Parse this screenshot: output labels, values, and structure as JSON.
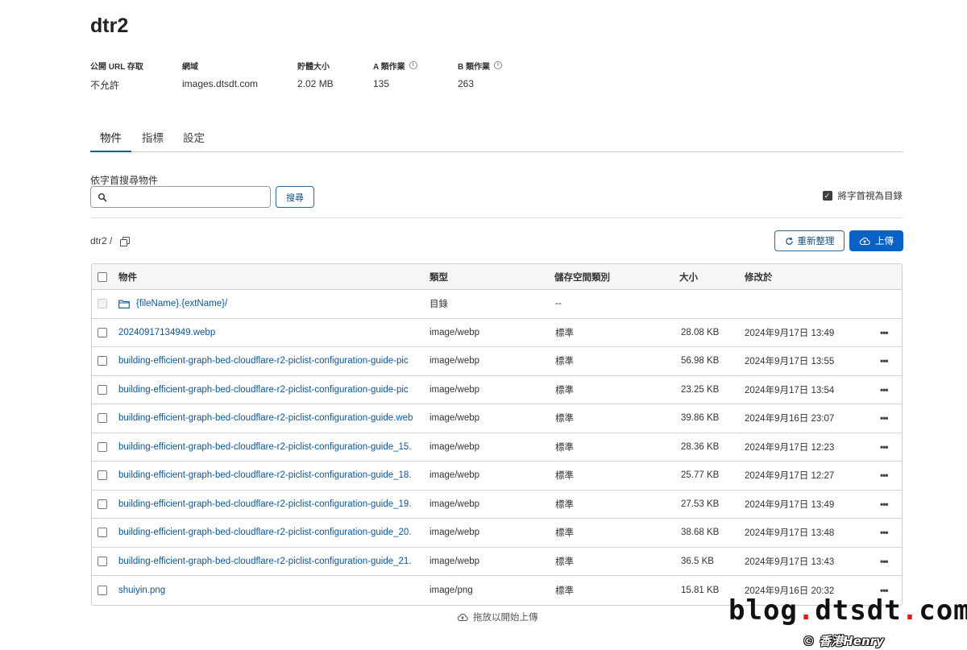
{
  "bucket": {
    "name": "dtr2",
    "meta": [
      {
        "label": "公開 URL 存取",
        "value": "不允許"
      },
      {
        "label": "網域",
        "value": "images.dtsdt.com"
      },
      {
        "label": "貯體大小",
        "value": "2.02 MB"
      },
      {
        "label": "A 類作業",
        "value": "135"
      },
      {
        "label": "B 類作業",
        "value": "263"
      }
    ]
  },
  "tabs": [
    {
      "label": "物件",
      "active": true
    },
    {
      "label": "指標",
      "active": false
    },
    {
      "label": "設定",
      "active": false
    }
  ],
  "search": {
    "label": "依字首搜尋物件",
    "value": "",
    "button": "搜尋",
    "dir_toggle_label": "將字首視為目錄",
    "dir_toggle_checked": true
  },
  "path": "dtr2 /",
  "actions": {
    "refresh": "重新整理",
    "upload": "上傳"
  },
  "table": {
    "headers": {
      "name": "物件",
      "type": "類型",
      "storage": "儲存空間類別",
      "size": "大小",
      "modified": "修改於"
    },
    "folder": {
      "name": "{fileName}.{extName}/",
      "type": "目錄",
      "storage": "--"
    },
    "rows": [
      {
        "name": "20240917134949.webp",
        "type": "image/webp",
        "storage": "標準",
        "size": "28.08 KB",
        "modified": "2024年9月17日 13:49"
      },
      {
        "name": "building-efficient-graph-bed-cloudflare-r2-piclist-configuration-guide-pic",
        "type": "image/webp",
        "storage": "標準",
        "size": "56.98 KB",
        "modified": "2024年9月17日 13:55"
      },
      {
        "name": "building-efficient-graph-bed-cloudflare-r2-piclist-configuration-guide-pic",
        "type": "image/webp",
        "storage": "標準",
        "size": "23.25 KB",
        "modified": "2024年9月17日 13:54"
      },
      {
        "name": "building-efficient-graph-bed-cloudflare-r2-piclist-configuration-guide.web",
        "type": "image/webp",
        "storage": "標準",
        "size": "39.86 KB",
        "modified": "2024年9月16日 23:07"
      },
      {
        "name": "building-efficient-graph-bed-cloudflare-r2-piclist-configuration-guide_15.",
        "type": "image/webp",
        "storage": "標準",
        "size": "28.36 KB",
        "modified": "2024年9月17日 12:23"
      },
      {
        "name": "building-efficient-graph-bed-cloudflare-r2-piclist-configuration-guide_18.",
        "type": "image/webp",
        "storage": "標準",
        "size": "25.77 KB",
        "modified": "2024年9月17日 12:27"
      },
      {
        "name": "building-efficient-graph-bed-cloudflare-r2-piclist-configuration-guide_19.",
        "type": "image/webp",
        "storage": "標準",
        "size": "27.53 KB",
        "modified": "2024年9月17日 13:49"
      },
      {
        "name": "building-efficient-graph-bed-cloudflare-r2-piclist-configuration-guide_20.",
        "type": "image/webp",
        "storage": "標準",
        "size": "38.68 KB",
        "modified": "2024年9月17日 13:48"
      },
      {
        "name": "building-efficient-graph-bed-cloudflare-r2-piclist-configuration-guide_21.",
        "type": "image/webp",
        "storage": "標準",
        "size": "36.5 KB",
        "modified": "2024年9月17日 13:43"
      },
      {
        "name": "shuiyin.png",
        "type": "image/png",
        "storage": "標準",
        "size": "15.81 KB",
        "modified": "2024年9月16日 20:32"
      }
    ]
  },
  "dropzone": "拖放以開始上傳",
  "watermark": {
    "site_prefix": "blog",
    "site_middle": "dtsdt",
    "site_suffix": "com",
    "credit": "© 香港Henry"
  },
  "colors": {
    "primary": "#0b62c5",
    "link": "#0c5696",
    "tab_underline": "#0f5ba7",
    "watermark_dot": "#e02020"
  }
}
